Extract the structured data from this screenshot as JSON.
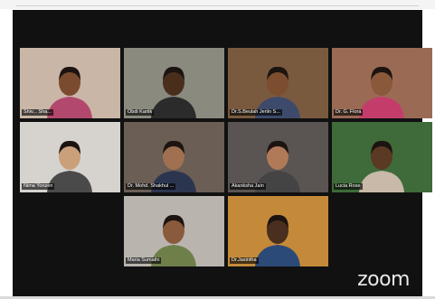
{
  "meeting": {
    "brand_label": "zoom",
    "participants": [
      {
        "name": "Shiv... Sha...",
        "active": true,
        "bg": "#c9b6a6",
        "shirt": "#b2486e",
        "skin": "#7a4b2e"
      },
      {
        "name": "Obdi Kartik",
        "active": false,
        "bg": "#8a8a7e",
        "shirt": "#2b2b2b",
        "skin": "#4a2e1c"
      },
      {
        "name": "Dr.S.Beulah Jerlin S...",
        "active": false,
        "bg": "#7a5a3e",
        "shirt": "#3d4a6b",
        "skin": "#7c4d2e"
      },
      {
        "name": "Dr. G. Flora",
        "active": false,
        "bg": "#9a6a55",
        "shirt": "#c43d6a",
        "skin": "#8a583a"
      },
      {
        "name": "Nima Yonzen",
        "active": false,
        "bg": "#d6d3cf",
        "shirt": "#4a4a4a",
        "skin": "#c9a07a"
      },
      {
        "name": "Dr. Mohd. Shakhul ...",
        "active": false,
        "bg": "#6a5e55",
        "shirt": "#2c3550",
        "skin": "#a07050"
      },
      {
        "name": "Akanksha Jain",
        "active": false,
        "bg": "#5a5452",
        "shirt": "#444444",
        "skin": "#b07a58"
      },
      {
        "name": "Lucia Rose",
        "active": false,
        "bg": "#3f6a3a",
        "shirt": "#c8b9a8",
        "skin": "#5a3a24"
      },
      {
        "name": "Maria Sumathi",
        "active": false,
        "bg": "#b9b4ae",
        "shirt": "#6e7f4a",
        "skin": "#8a5a3c"
      },
      {
        "name": "Dr.Jasintha",
        "active": false,
        "bg": "#c48a3a",
        "shirt": "#2c4a78",
        "skin": "#4a2e1e"
      }
    ]
  }
}
